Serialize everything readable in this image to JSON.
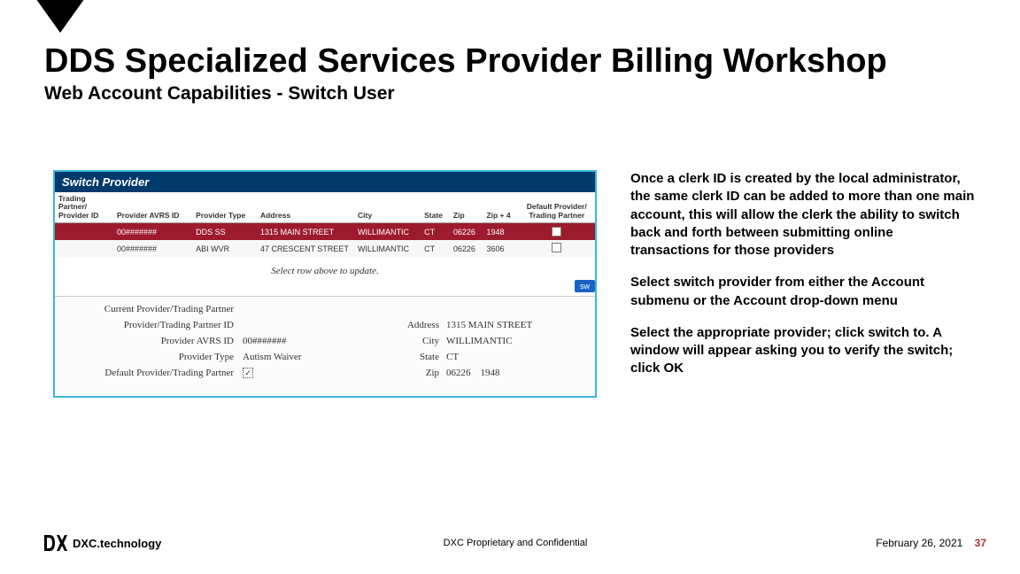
{
  "header": {
    "title": "DDS Specialized Services Provider Billing Workshop",
    "subtitle": "Web Account Capabilities - Switch User"
  },
  "switch_panel": {
    "heading": "Switch Provider",
    "columns": {
      "c1": "Trading Partner/\nProvider ID",
      "c2": "Provider AVRS ID",
      "c3": "Provider Type",
      "c4": "Address",
      "c5": "City",
      "c6": "State",
      "c7": "Zip",
      "c8": "Zip + 4",
      "c9": "Default Provider/\nTrading Partner"
    },
    "rows": [
      {
        "pid": "",
        "avrs": "00#######",
        "ptype": "DDS SS",
        "addr": "1315 MAIN STREET",
        "city": "WILLIMANTIC",
        "state": "CT",
        "zip": "06226",
        "zip4": "1948",
        "chk": "✓"
      },
      {
        "pid": "",
        "avrs": "00#######",
        "ptype": "ABI WVR",
        "addr": "47 CRESCENT STREET",
        "city": "WILLIMANTIC",
        "state": "CT",
        "zip": "06226",
        "zip4": "3606",
        "chk": ""
      }
    ],
    "prompt": "Select row above to update.",
    "button": "sw",
    "details": {
      "l1": "Current Provider/Trading Partner",
      "v1": "",
      "l2": "Provider/Trading Partner ID",
      "v2": "",
      "l2b": "Address",
      "v2b": "1315 MAIN STREET",
      "l3": "Provider AVRS ID",
      "v3": "00#######",
      "l3b": "City",
      "v3b": "WILLIMANTIC",
      "l4": "Provider Type",
      "v4": "Autism Waiver",
      "l4b": "State",
      "v4b": "CT",
      "l5": "Default Provider/Trading Partner",
      "v5": "✓",
      "l5b": "Zip",
      "v5b": "06226    1948"
    }
  },
  "notes": {
    "p1": "Once a clerk ID is created by the local administrator, the same clerk ID can be added to more than one main account, this will allow the clerk the ability to switch back and forth between submitting online transactions for those providers",
    "p2": "Select switch provider from either the Account submenu or the Account drop-down menu",
    "p3": "Select the appropriate provider; click switch to. A window will appear asking you to verify the switch; click OK"
  },
  "footer": {
    "logo_text": "DXC.technology",
    "center": "DXC Proprietary and Confidential",
    "date": "February 26, 2021",
    "page": "37"
  }
}
